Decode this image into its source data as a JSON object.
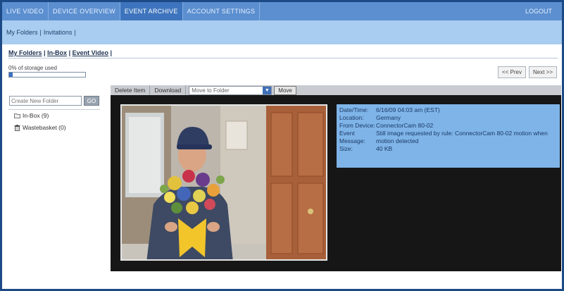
{
  "nav": {
    "tabs": [
      "LIVE VIDEO",
      "DEVICE OVERVIEW",
      "EVENT ARCHIVE",
      "ACCOUNT SETTINGS"
    ],
    "active_index": 2,
    "logout": "LOGOUT"
  },
  "subnav": {
    "items": [
      "My Folders",
      "Invitations"
    ]
  },
  "folder_links": [
    "My Folders",
    "In-Box",
    "Event Video"
  ],
  "storage": {
    "label": "0% of storage used",
    "percent": 0.05
  },
  "pager": {
    "prev": "<< Prev",
    "next": "Next >>"
  },
  "left_panel": {
    "create_placeholder": "Create New Folder",
    "go_label": "GO",
    "folders": [
      {
        "label": "In-Box (9)",
        "icon": "folder-icon"
      },
      {
        "label": "Wastebasket (0)",
        "icon": "trash-icon"
      }
    ]
  },
  "toolbar": {
    "delete": "Delete Item",
    "download": "Download",
    "move_select": "Move to Folder",
    "move_btn": "Move"
  },
  "info": {
    "rows": [
      {
        "key": "Date/Time:",
        "value": "6/16/09 04:03 am (EST)"
      },
      {
        "key": "Location:",
        "value": "Germany"
      },
      {
        "key": "From Device:",
        "value": "ConnectorCam 80-02"
      },
      {
        "key": "Event Message:",
        "value": "Still image requested by rule: ConnectorCam 80-02 motion when motion detected"
      },
      {
        "key": "Size:",
        "value": "40 KB"
      }
    ]
  },
  "colors": {
    "nav_bg": "#5b8fd0",
    "subnav_bg": "#a9cdf0",
    "info_bg": "#7fb4e8",
    "viewer_bg": "#161616",
    "frame": "#1c4a86"
  }
}
